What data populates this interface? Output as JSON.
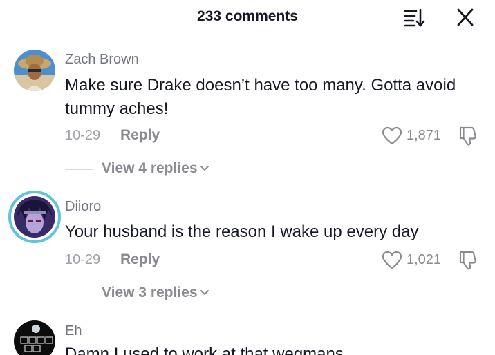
{
  "header": {
    "title": "233 comments",
    "sort_icon": "sort-icon",
    "close_icon": "close-icon"
  },
  "comments": [
    {
      "username": "Zach Brown",
      "text": "Make sure Drake doesn’t have too many. Gotta avoid tummy aches!",
      "date": "10-29",
      "reply_label": "Reply",
      "likes": "1,871",
      "view_replies": "View 4 replies"
    },
    {
      "username": "Diioro",
      "text": "Your husband is the reason I wake up every day",
      "date": "10-29",
      "reply_label": "Reply",
      "likes": "1,021",
      "view_replies": "View 3 replies"
    },
    {
      "username": "Eh",
      "text": "Damn I used to work at that wegmans"
    }
  ],
  "colors": {
    "text_primary": "#161823",
    "text_secondary": "#8a8b91",
    "avatar_ring": "#5fc4d8"
  }
}
